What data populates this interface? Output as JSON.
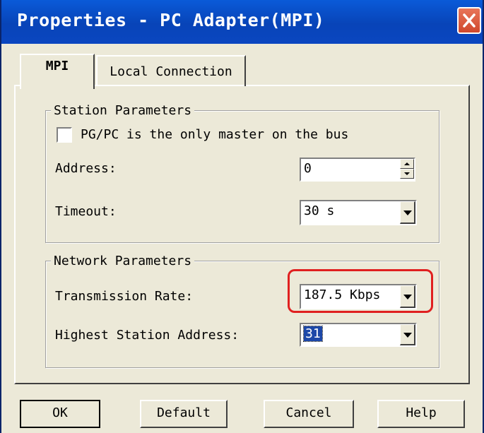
{
  "window": {
    "title": "Properties - PC Adapter(MPI)",
    "close_icon": "close-x-icon"
  },
  "tabs": [
    {
      "label": "MPI",
      "active": true
    },
    {
      "label": "Local Connection",
      "active": false
    }
  ],
  "station_parameters": {
    "legend": "Station Parameters",
    "only_master_checkbox": {
      "label": "PG/PC is the only master on the bus",
      "checked": false
    },
    "address": {
      "label": "Address:",
      "value": "0"
    },
    "timeout": {
      "label": "Timeout:",
      "value": "30 s"
    }
  },
  "network_parameters": {
    "legend": "Network Parameters",
    "transmission_rate": {
      "label": "Transmission Rate:",
      "value": "187.5 Kbps"
    },
    "highest_station_address": {
      "label": "Highest Station Address:",
      "value": "31"
    }
  },
  "buttons": {
    "ok": "OK",
    "default": "Default",
    "cancel": "Cancel",
    "help": "Help"
  },
  "colors": {
    "titlebar": "#0a46c0",
    "dialog_bg": "#ece9d8",
    "highlight": "#e02020",
    "selection": "#1d48a8"
  }
}
